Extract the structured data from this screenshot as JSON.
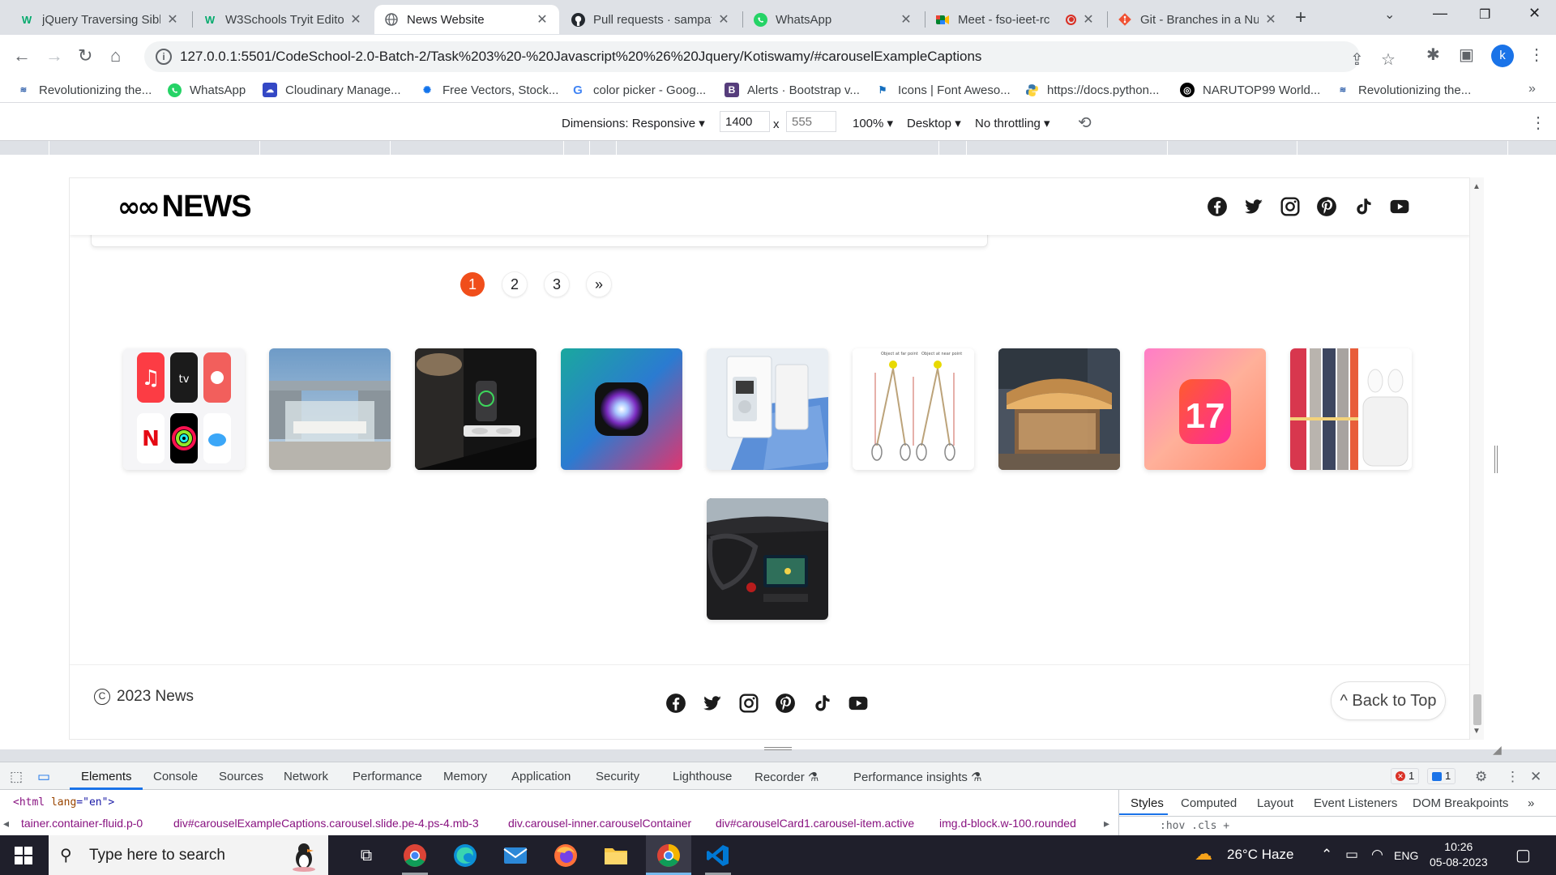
{
  "browser": {
    "tabs": [
      {
        "title": "jQuery Traversing Sibl",
        "icon": "w3schools-icon",
        "active": false
      },
      {
        "title": "W3Schools Tryit Edito",
        "icon": "w3schools-icon",
        "active": false
      },
      {
        "title": "News Website",
        "icon": "globe-icon",
        "active": true
      },
      {
        "title": "Pull requests · sampat",
        "icon": "github-icon",
        "active": false
      },
      {
        "title": "WhatsApp",
        "icon": "whatsapp-icon",
        "active": false
      },
      {
        "title": "Meet - fso-ieet-rc",
        "icon": "meet-icon",
        "active": false
      },
      {
        "title": "Git - Branches in a Nu",
        "icon": "git-icon",
        "active": false
      }
    ],
    "url": "127.0.0.1:5501/CodeSchool-2.0-Batch-2/Task%203%20-%20Javascript%20%26%20Jquery/Kotiswamy/#carouselExampleCaptions",
    "profile_initial": "k",
    "bookmarks": [
      {
        "label": "Revolutionizing the..."
      },
      {
        "label": "WhatsApp"
      },
      {
        "label": "Cloudinary Manage..."
      },
      {
        "label": "Free Vectors, Stock..."
      },
      {
        "label": "color picker - Goog..."
      },
      {
        "label": "Alerts · Bootstrap v..."
      },
      {
        "label": "Icons | Font Aweso..."
      },
      {
        "label": "https://docs.python..."
      },
      {
        "label": "NARUTOP99 World..."
      },
      {
        "label": "Revolutionizing the..."
      }
    ]
  },
  "device_toolbar": {
    "dimensions_label": "Dimensions: Responsive ▾",
    "width": "1400",
    "height_placeholder": "555",
    "times": "x",
    "zoom": "100% ▾",
    "device_type": "Desktop ▾",
    "throttling": "No throttling ▾"
  },
  "site": {
    "logo_text": "NEWS",
    "pagination": [
      "1",
      "2",
      "3",
      "»"
    ],
    "active_page": "1",
    "thumbnails": [
      "apple-services-apps",
      "apple-store-glass",
      "magsafe-charging-stand",
      "siri-orb",
      "ipod-box",
      "diagram-drawing",
      "apple-store-building",
      "ios-17-logo",
      "watch-bands-airpods",
      "car-dashboard"
    ],
    "footer": {
      "copyright_symbol": "C",
      "copyright_text": "2023 News",
      "back_to_top": "^ Back to Top"
    },
    "social_icons": [
      "facebook-icon",
      "twitter-icon",
      "instagram-icon",
      "pinterest-icon",
      "tiktok-icon",
      "youtube-icon"
    ]
  },
  "devtools": {
    "tabs": [
      "Elements",
      "Console",
      "Sources",
      "Network",
      "Performance",
      "Memory",
      "Application",
      "Security",
      "Lighthouse",
      "Recorder ⚗",
      "Performance insights ⚗"
    ],
    "errors": "1",
    "messages": "1",
    "dom_line": {
      "tag_open": "<html ",
      "attr": "lang",
      "eq": "=\"",
      "value": "en",
      "close": "\">"
    },
    "breadcrumbs": [
      "tainer.container-fluid.p-0",
      "div#carouselExampleCaptions.carousel.slide.pe-4.ps-4.mb-3",
      "div.carousel-inner.carouselContainer",
      "div#carouselCard1.carousel-item.active",
      "img.d-block.w-100.rounded"
    ],
    "side_tabs": [
      "Styles",
      "Computed",
      "Layout",
      "Event Listeners",
      "DOM Breakpoints"
    ],
    "filter_text": ":hov  .cls  +"
  },
  "taskbar": {
    "search_placeholder": "Type here to search",
    "weather": "26°C  Haze",
    "language": "ENG",
    "time": "10:26",
    "date": "05-08-2023"
  },
  "colors": {
    "accent_orange": "#f04e1b",
    "chrome_blue": "#1a73e8",
    "taskbar": "#1f1f2b"
  }
}
